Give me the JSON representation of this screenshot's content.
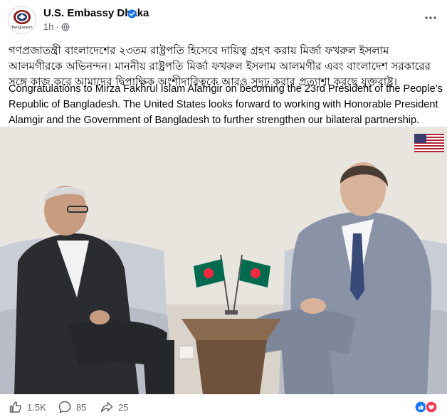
{
  "post": {
    "page_name": "U.S. Embassy Dhaka",
    "avatar_label": "Bangladesh",
    "avatar_seal_text": "U.S. EMBASSY",
    "time": "1h",
    "time_separator": "·",
    "text_bn": "গণপ্রজাতন্ত্রী বাংলাদেশের ২৩তম রাষ্ট্রপতি হিসেবে দায়িত্ব গ্রহণ করায় মির্জা ফখরুল ইসলাম আলমগীরকে অভিনন্দন। মাননীয় রাষ্ট্রপতি মির্জা ফখরুল ইসলাম আলমগীর এবং বাংলাদেশ সরকারের সঙ্গে কাজ করে আমাদের দ্বিপাক্ষিক অংশীদারিত্বকে আরও সুদৃঢ় করার প্রত্যাশা করছে যুক্তরাষ্ট্র।",
    "text_en": "Congratulations to Mirza Fakhrul Islam Alamgir on becoming the 23rd President of the People’s Republic of Bangladesh. The United States looks forward to working with Honorable President Alamgir and the Government of Bangladesh to further strengthen our bilateral partnership."
  },
  "icons": {
    "verified": "verified-badge-icon",
    "privacy": "globe-icon",
    "more": "more-options-icon",
    "like": "like-icon",
    "comment": "comment-icon",
    "share": "share-icon"
  },
  "footer": {
    "likes": "1.5K",
    "comments": "85",
    "shares": "25"
  },
  "colors": {
    "verified": "#1877f2",
    "muted_text": "#65676b",
    "bd_green": "#006a4e",
    "bd_red": "#f42a41"
  }
}
